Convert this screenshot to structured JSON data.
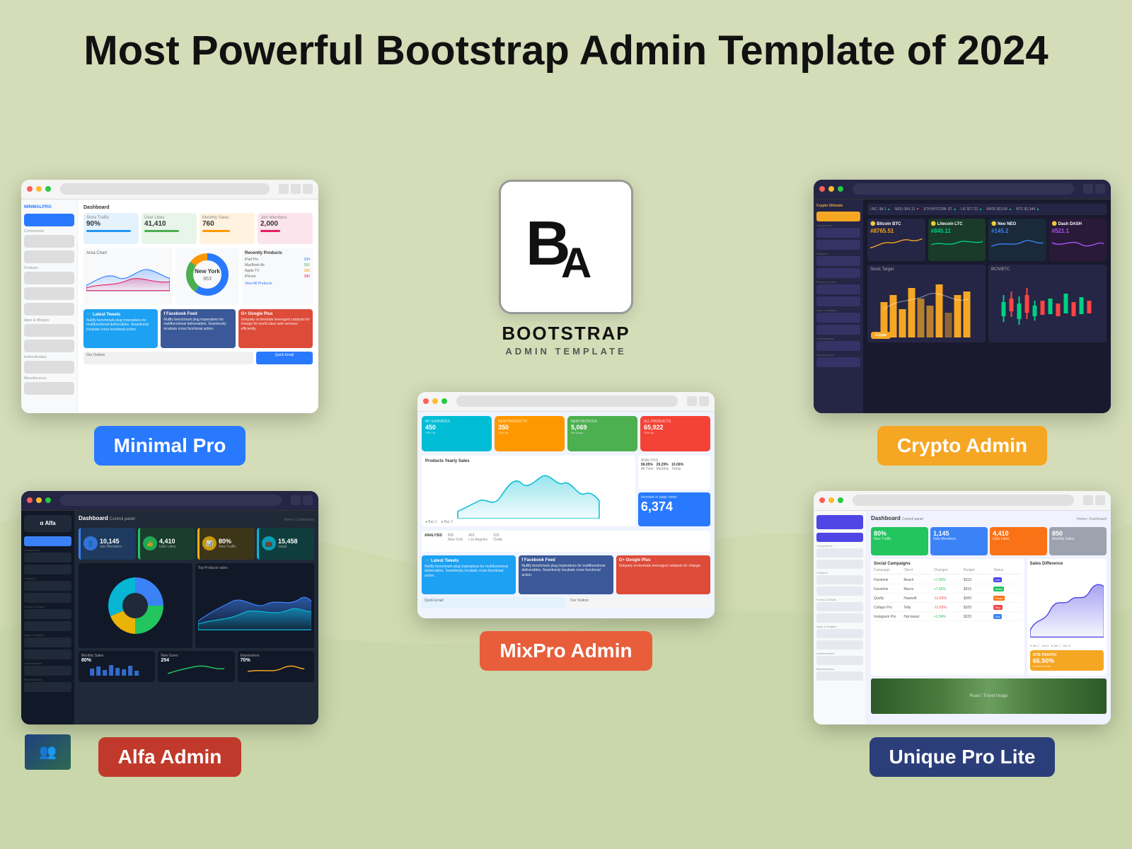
{
  "page": {
    "title": "Most Powerful Bootstrap Admin Template of 2024",
    "bg_color": "#d4ddb8"
  },
  "logo": {
    "main_text": "BOOTSTRAP",
    "sub_text": "ADMIN TEMPLATE"
  },
  "templates": {
    "minimal_pro": {
      "label": "Minimal Pro",
      "label_bg": "#2979ff",
      "stats": [
        {
          "label": "Store Traffic",
          "value": "90%"
        },
        {
          "label": "User Likes",
          "value": "41,410"
        },
        {
          "label": "Monthly Sales",
          "value": "760"
        },
        {
          "label": "Join Members",
          "value": "2,000"
        }
      ],
      "social": [
        "Latest Tweets",
        "Facebook Feed",
        "Google Plus"
      ]
    },
    "crypto_admin": {
      "label": "Crypto Admin",
      "label_bg": "#f5a623",
      "coins": [
        {
          "name": "Bitcoin BTC",
          "value": "#8765.51"
        },
        {
          "name": "Litecoin LTC",
          "value": "#845.11"
        },
        {
          "name": "Neo NEO",
          "value": "#145.2"
        },
        {
          "name": "Dash DASH",
          "value": "#521.1"
        }
      ],
      "charts": [
        "Stock Target",
        "BCN/BTC"
      ]
    },
    "mixpro_admin": {
      "label": "MixPro Admin",
      "label_bg": "#e85d3a",
      "kpis": [
        {
          "label": "MY EARNINGS",
          "value": "450",
          "change": "+9% Up"
        },
        {
          "label": "NEW PRODUCTS",
          "value": "350",
          "change": "10% Up"
        },
        {
          "label": "NEW INVOICES",
          "value": "5,069",
          "change": "5% Down"
        },
        {
          "label": "ALL PRODUCTS",
          "value": "65,922",
          "change": "70% Up"
        }
      ],
      "big_number": "6,374",
      "social": [
        "Latest Tweets",
        "Facebook Feed",
        "Google Plus"
      ]
    },
    "alfa_admin": {
      "label": "Alfa Admin",
      "label_bg": "#c0392b",
      "kpis": [
        {
          "label": "Join Members",
          "value": "10,145"
        },
        {
          "label": "User Likes",
          "value": "4,410"
        },
        {
          "label": "New Traffic",
          "value": "80%"
        },
        {
          "label": "Value",
          "value": "15,458"
        }
      ]
    },
    "unique_pro_lite": {
      "label": "Unique Pro Lite",
      "label_bg": "#2c3e7a",
      "kpis": [
        {
          "label": "New Traffic",
          "value": "80%"
        },
        {
          "label": "New Members",
          "value": "1,145"
        },
        {
          "label": "User Likes",
          "value": "4,410"
        },
        {
          "label": "Monthly Sales",
          "value": "850"
        }
      ],
      "table_headers": [
        "Campaign",
        "Client",
        "Changes",
        "Budget",
        "Status"
      ],
      "table_rows": [
        [
          "Facetime",
          "Beach",
          "+7.43%",
          "$315",
          ""
        ],
        [
          "Facetime",
          "Macro",
          "+7.43%",
          "$315",
          ""
        ],
        [
          "Quolly",
          "Hawsoft",
          "-11.63%",
          "$300",
          ""
        ],
        [
          "Collaps Pro",
          "Telly",
          "-11.63%",
          "$325",
          ""
        ],
        [
          "Instagram Pro",
          "Hat kwust",
          "+1.54%",
          "$225",
          ""
        ]
      ]
    }
  }
}
